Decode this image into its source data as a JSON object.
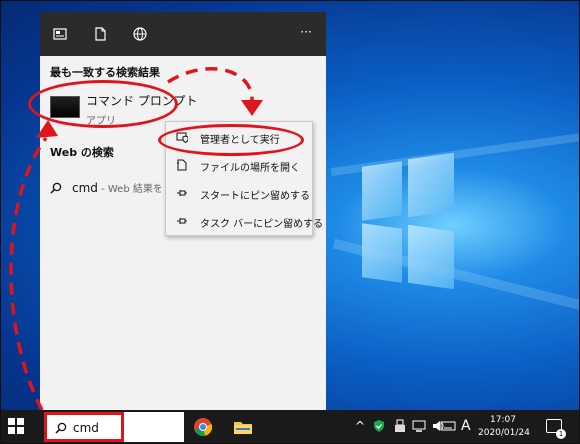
{
  "panel": {
    "best_match_header": "最も一致する検索結果",
    "app_name": "コマンド プロンプト",
    "app_type": "アプリ",
    "web_header": "Web の検索",
    "web_query": "cmd",
    "web_suffix": " - Web 結果を",
    "more_label": "···"
  },
  "context_menu": {
    "items": [
      {
        "label": "管理者として実行",
        "icon": "shield-icon"
      },
      {
        "label": "ファイルの場所を開く",
        "icon": "folder-icon"
      },
      {
        "label": "スタートにピン留めする",
        "icon": "pin-icon"
      },
      {
        "label": "タスク バーにピン留めする",
        "icon": "pin-icon"
      }
    ]
  },
  "taskbar": {
    "search_value": "cmd",
    "time": "17:07",
    "date": "2020/01/24",
    "ime_label": "A",
    "notification_count": "1"
  },
  "colors": {
    "annotation_red": "#e0151b",
    "panel_bg": "#f2f2f2",
    "toolbar_bg": "#2b2b2b",
    "taskbar_bg": "#1a1a1a"
  }
}
